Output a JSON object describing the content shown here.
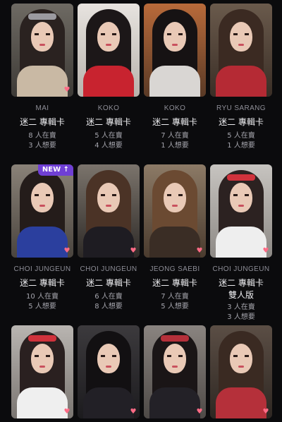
{
  "cards": [
    {
      "member": "MAI",
      "title": "迷二 專輯卡",
      "sub": "",
      "selling": "8 人在賣",
      "wanting": "3 人想要",
      "badge": "",
      "favorited": true
    },
    {
      "member": "KOKO",
      "title": "迷二 專輯卡",
      "sub": "",
      "selling": "5 人在賣",
      "wanting": "4 人想要",
      "badge": "",
      "favorited": false
    },
    {
      "member": "KOKO",
      "title": "迷二 專輯卡",
      "sub": "",
      "selling": "7 人在賣",
      "wanting": "1 人想要",
      "badge": "",
      "favorited": false
    },
    {
      "member": "RYU SARANG",
      "title": "迷二 專輯卡",
      "sub": "",
      "selling": "5 人在賣",
      "wanting": "1 人想要",
      "badge": "",
      "favorited": false
    },
    {
      "member": "CHOI JUNGEUN",
      "title": "迷二 專輯卡",
      "sub": "",
      "selling": "10 人在賣",
      "wanting": "5 人想要",
      "badge": "NEW ↑",
      "favorited": true
    },
    {
      "member": "CHOI JUNGEUN",
      "title": "迷二 專輯卡",
      "sub": "",
      "selling": "6 人在賣",
      "wanting": "8 人想要",
      "badge": "",
      "favorited": true
    },
    {
      "member": "JEONG SAEBI",
      "title": "迷二 專輯卡",
      "sub": "",
      "selling": "7 人在賣",
      "wanting": "5 人想要",
      "badge": "",
      "favorited": true
    },
    {
      "member": "CHOI JUNGEUN",
      "title": "迷二 專輯卡",
      "sub": "雙人版",
      "selling": "3 人在賣",
      "wanting": "3 人想要",
      "badge": "",
      "favorited": true
    },
    {
      "member": "",
      "title": "",
      "sub": "",
      "selling": "",
      "wanting": "",
      "badge": "",
      "favorited": true
    },
    {
      "member": "",
      "title": "",
      "sub": "",
      "selling": "",
      "wanting": "",
      "badge": "",
      "favorited": true
    },
    {
      "member": "",
      "title": "",
      "sub": "",
      "selling": "",
      "wanting": "",
      "badge": "",
      "favorited": true
    },
    {
      "member": "",
      "title": "",
      "sub": "",
      "selling": "",
      "wanting": "",
      "badge": "",
      "favorited": true
    }
  ],
  "icons": {
    "favorite": "heart-icon",
    "new": "arrow-up-icon"
  },
  "colors": {
    "heart": "#ff6b86",
    "badge": "#6f3fd4",
    "background": "#0b0b0d"
  }
}
